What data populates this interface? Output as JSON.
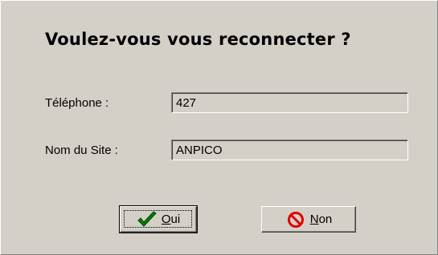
{
  "dialog": {
    "title": "Voulez-vous vous reconnecter ?"
  },
  "fields": {
    "phone_label": "Téléphone :",
    "phone_value": "427",
    "site_label": "Nom du Site :",
    "site_value": "ANPICO"
  },
  "buttons": {
    "oui": {
      "mnemonic": "O",
      "rest": "ui",
      "icon": "checkmark-icon",
      "icon_color": "#008000"
    },
    "non": {
      "mnemonic": "N",
      "rest": "on",
      "icon": "no-entry-icon",
      "icon_color": "#e00000"
    }
  }
}
